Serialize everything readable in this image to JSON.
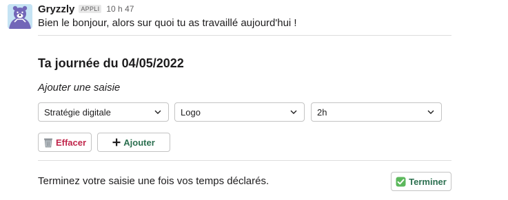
{
  "message": {
    "author": "Gryzzly",
    "app_badge": "APPLI",
    "timestamp": "10 h 47",
    "text": "Bien le bonjour, alors sur quoi tu as travaillé aujourd'hui !"
  },
  "form": {
    "title": "Ta journée du 04/05/2022",
    "add_label": "Ajouter une saisie",
    "selects": {
      "category": "Stratégie digitale",
      "task": "Logo",
      "duration": "2h"
    },
    "clear_button": "Effacer",
    "add_button": "Ajouter",
    "finish_text": "Terminez votre saisie une fois vos temps déclarés.",
    "finish_button": "Terminer"
  },
  "icons": {
    "clear": "wastebasket-icon",
    "add": "plus-icon",
    "finish": "check-mark-icon",
    "dropdown": "chevron-down-icon"
  },
  "colors": {
    "danger": "#c0254a",
    "success": "#2b6f4f",
    "check_green": "#5cb85c"
  }
}
